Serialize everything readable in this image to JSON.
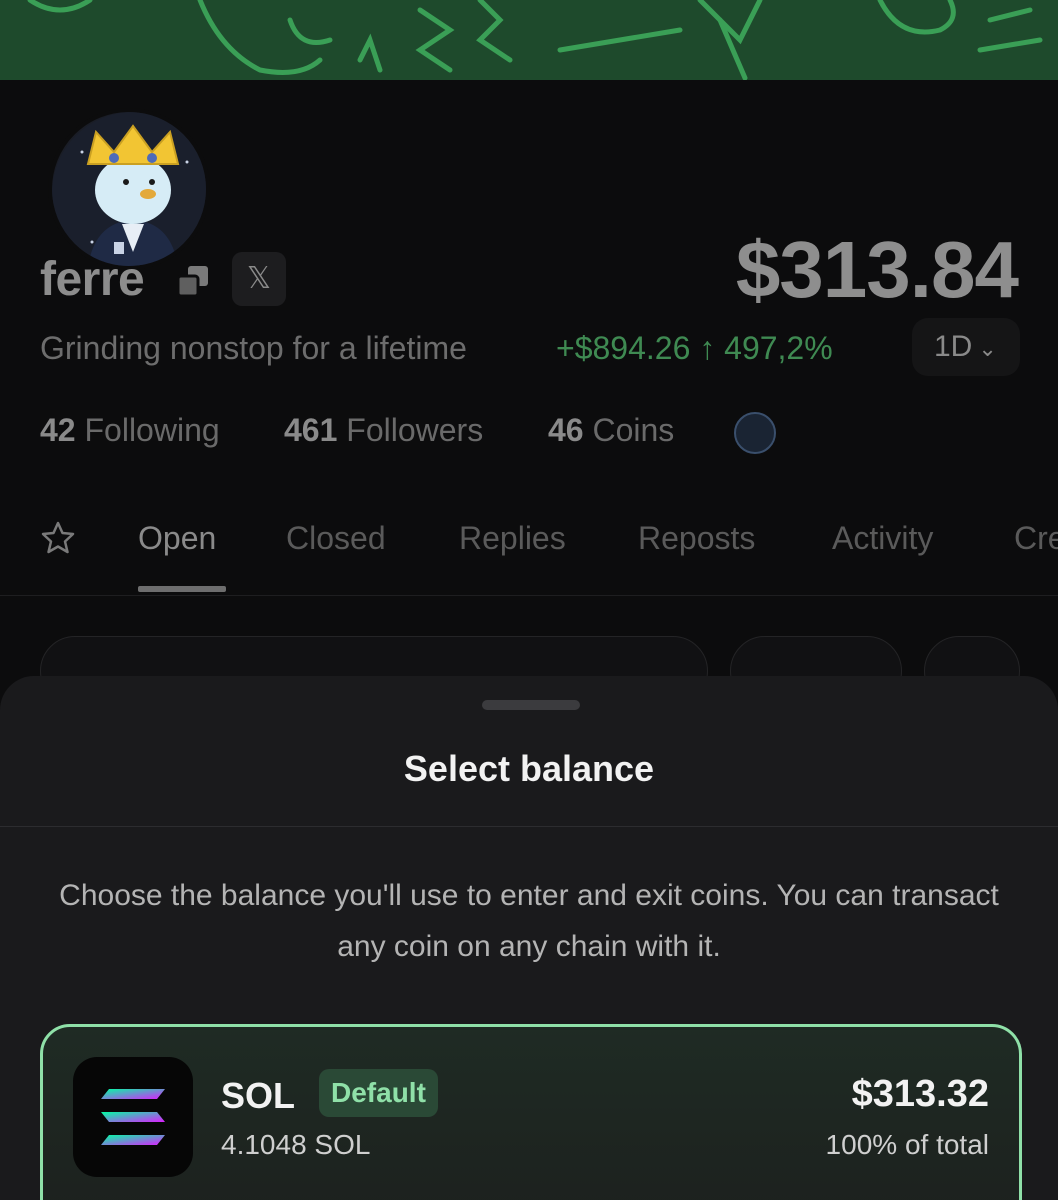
{
  "profile": {
    "username": "ferre",
    "x_label": "𝕏",
    "bio": "Grinding nonstop for a lifetime",
    "portfolio_value": "$313.84",
    "change": "+$894.26 ↑ 497,2%",
    "period": "1D",
    "stats": {
      "following_count": "42",
      "following_label": "Following",
      "followers_count": "461",
      "followers_label": "Followers",
      "coins_count": "46",
      "coins_label": "Coins"
    }
  },
  "tabs": [
    {
      "label": "Open",
      "active": true
    },
    {
      "label": "Closed"
    },
    {
      "label": "Replies"
    },
    {
      "label": "Reposts"
    },
    {
      "label": "Activity"
    },
    {
      "label": "Cre"
    }
  ],
  "sheet": {
    "title": "Select balance",
    "description": "Choose the balance you'll use to enter and exit coins. You can transact any coin on any chain with it.",
    "balances": [
      {
        "symbol": "SOL",
        "badge": "Default",
        "amount": "4.1048 SOL",
        "usd": "$313.32",
        "share": "100% of total",
        "icon": "solana-icon"
      }
    ]
  },
  "colors": {
    "accent_green": "#8fe0a8",
    "positive": "#3f8a52",
    "banner": "#1e4a2c"
  }
}
